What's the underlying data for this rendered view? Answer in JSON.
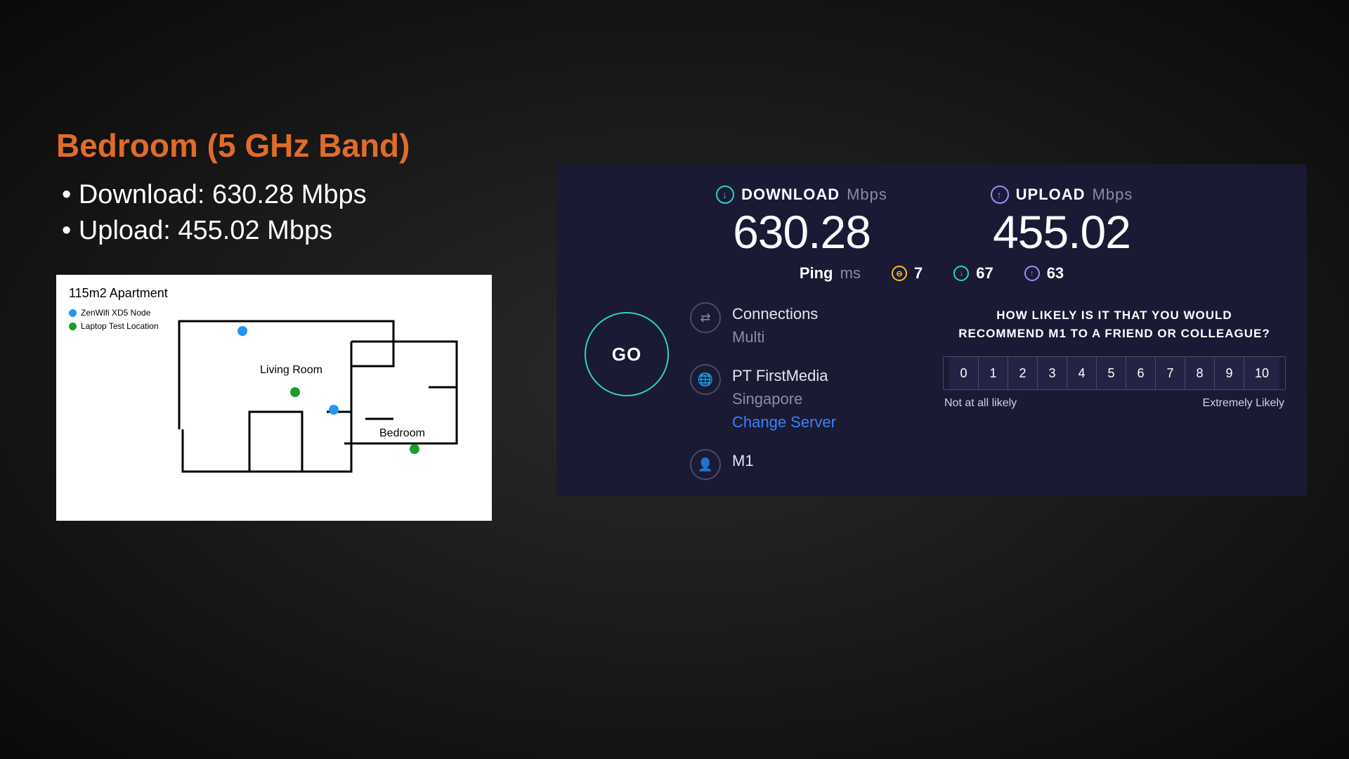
{
  "slide": {
    "title": "Bedroom (5 GHz Band)",
    "bullet_download": "• Download: 630.28 Mbps",
    "bullet_upload": "• Upload: 455.02 Mbps"
  },
  "floorplan": {
    "title": "115m2 Apartment",
    "legend_node": "ZenWifi XD5 Node",
    "legend_test": "Laptop Test Location",
    "room_living": "Living Room",
    "room_bedroom": "Bedroom"
  },
  "speedtest": {
    "download": {
      "icon": "↓",
      "label": "DOWNLOAD",
      "unit": "Mbps",
      "value": "630.28"
    },
    "upload": {
      "icon": "↑",
      "label": "UPLOAD",
      "unit": "Mbps",
      "value": "455.02"
    },
    "ping": {
      "label": "Ping",
      "unit": "ms",
      "idle": {
        "icon": "⊖",
        "value": "7"
      },
      "down_lat": {
        "icon": "↓",
        "value": "67"
      },
      "up_lat": {
        "icon": "↑",
        "value": "63"
      }
    },
    "go": "GO",
    "connections": {
      "label": "Connections",
      "value": "Multi"
    },
    "server": {
      "name": "PT FirstMedia",
      "location": "Singapore",
      "change": "Change Server"
    },
    "isp": {
      "name": "M1"
    },
    "survey": {
      "question_l1": "HOW LIKELY IS IT THAT YOU WOULD",
      "question_l2": "RECOMMEND M1 TO A FRIEND OR COLLEAGUE?",
      "options": [
        "0",
        "1",
        "2",
        "3",
        "4",
        "5",
        "6",
        "7",
        "8",
        "9",
        "10"
      ],
      "label_low": "Not at all likely",
      "label_high": "Extremely Likely"
    }
  }
}
